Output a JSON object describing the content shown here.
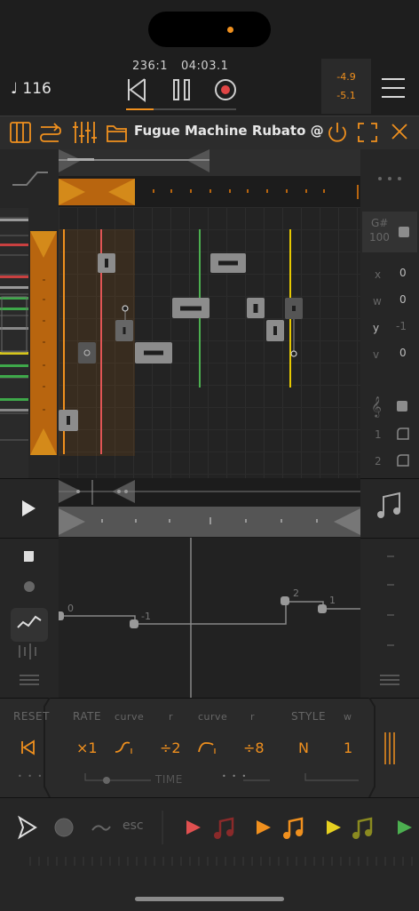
{
  "status": {
    "position": "236:1",
    "time": "04:03.1",
    "tempo": "♩ 116",
    "meter_top": "-4.9",
    "meter_bottom": "-5.1",
    "progress": 0.25
  },
  "title": "Fugue Machine Rubato @M...",
  "note_info": {
    "pitch": "G#",
    "velocity": "100"
  },
  "props": {
    "x_label": "x",
    "x": "0",
    "w_label": "w",
    "w": "0",
    "y_label": "y",
    "y": "-1",
    "v_label": "v",
    "v": "0"
  },
  "tracks": {
    "t1": "1",
    "t2": "2"
  },
  "curve_labels": {
    "a": "0",
    "b": "-1",
    "c": "2",
    "d": "1"
  },
  "bottom": {
    "reset": "RESET",
    "rate": "RATE",
    "curve1": "curve",
    "r1": "r",
    "curve2": "curve",
    "r2": "r",
    "style": "STYLE",
    "w": "w",
    "x1": "×1",
    "div2": "÷2",
    "div8": "÷8",
    "n": "N",
    "one": "1",
    "time": "TIME",
    "dots1": "• • •",
    "dots2": "• • •"
  },
  "dock": {
    "esc": "esc"
  },
  "colors": {
    "accent": "#f0901e",
    "red": "#e05050",
    "green": "#4caf50",
    "yellow": "#e6d020",
    "ref_orange": "#f0901e",
    "ref_red": "#e05555",
    "ref_green": "#4caf50",
    "ref_yellow": "#e6c800"
  }
}
